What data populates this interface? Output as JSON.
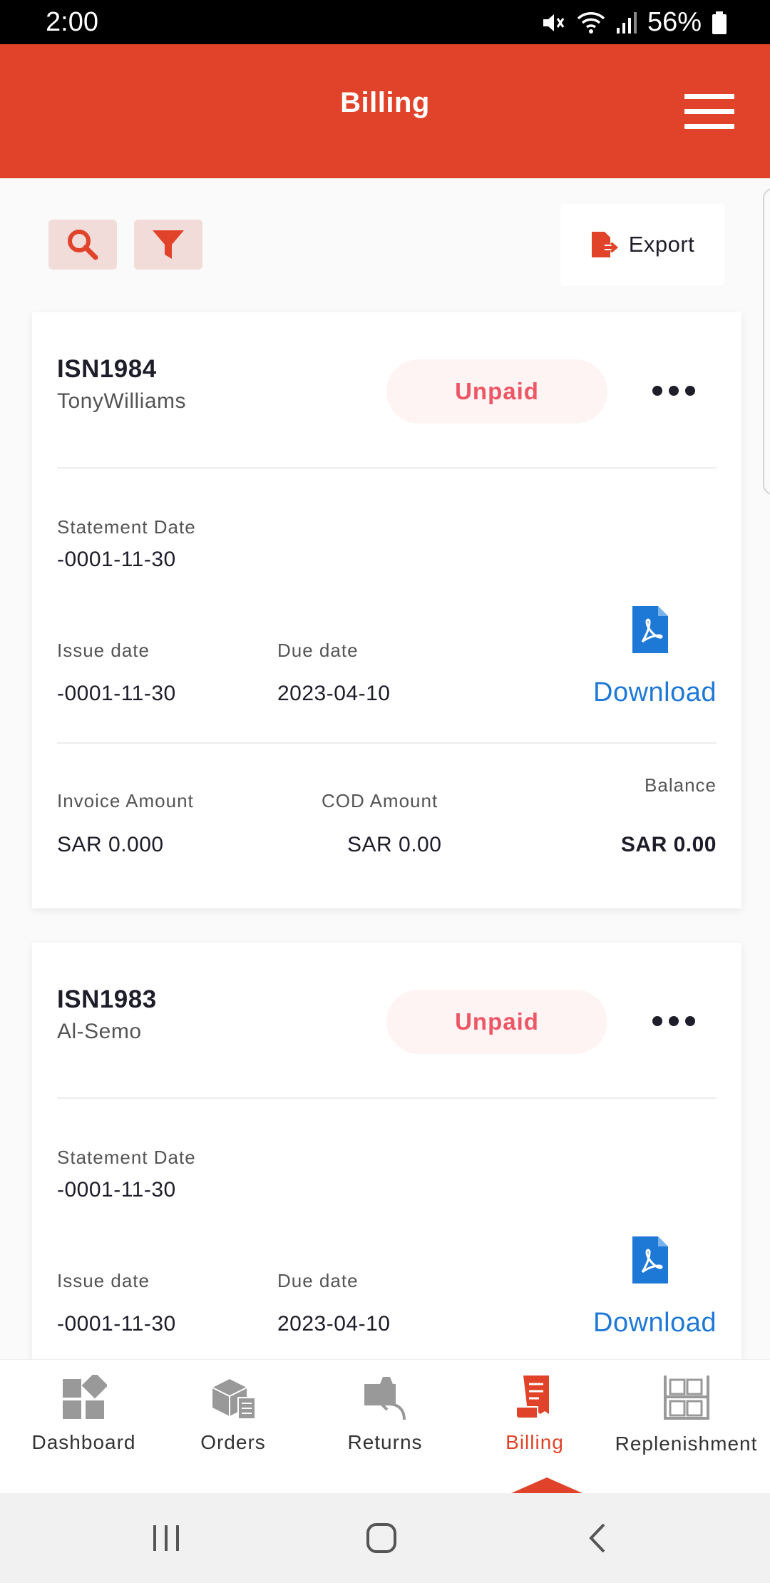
{
  "status_bar": {
    "time": "2:00",
    "battery": "56%"
  },
  "header": {
    "title": "Billing"
  },
  "toolbar": {
    "export_label": "Export"
  },
  "cards": [
    {
      "id": "ISN1984",
      "client": "TonyWilliams",
      "status": "Unpaid",
      "statement_label": "Statement Date",
      "statement_date": "-0001-11-30",
      "issue_label": "Issue date",
      "issue_date": "-0001-11-30",
      "due_label": "Due date",
      "due_date": "2023-04-10",
      "download_label": "Download",
      "invoice_amount_label": "Invoice Amount",
      "invoice_amount": "SAR 0.000",
      "cod_amount_label": "COD Amount",
      "cod_amount": "SAR 0.00",
      "balance_label": "Balance",
      "balance": "SAR 0.00"
    },
    {
      "id": "ISN1983",
      "client": "Al-Semo",
      "status": "Unpaid",
      "statement_label": "Statement Date",
      "statement_date": "-0001-11-30",
      "issue_label": "Issue date",
      "issue_date": "-0001-11-30",
      "due_label": "Due date",
      "due_date": "2023-04-10",
      "download_label": "Download"
    }
  ],
  "bottom_nav": {
    "items": [
      {
        "label": "Dashboard",
        "icon": "dashboard-icon"
      },
      {
        "label": "Orders",
        "icon": "orders-icon"
      },
      {
        "label": "Returns",
        "icon": "returns-icon"
      },
      {
        "label": "Billing",
        "icon": "billing-icon",
        "active": true
      },
      {
        "label": "Replenishment",
        "icon": "replenishment-icon"
      }
    ]
  },
  "colors": {
    "brand": "#e1432a",
    "unpaid": "#ec5766",
    "link": "#1e78d6"
  }
}
